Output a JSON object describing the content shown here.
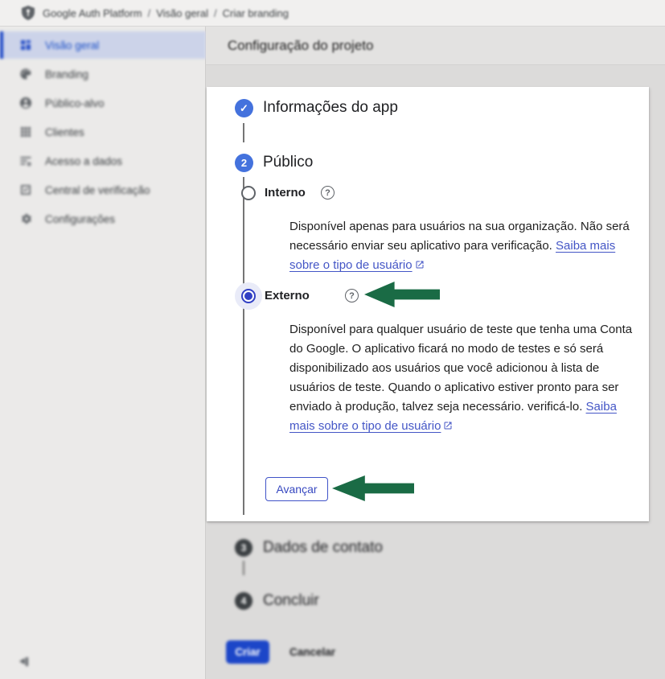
{
  "colors": {
    "step_blue": "#4472dd",
    "radio_selected_blue": "#3140c4",
    "link_blue": "#4456c6",
    "create_button_blue": "#1c46c8",
    "annotation_arrow_green": "#1a6b45",
    "sidebar_selected_bg": "#ccd3e9",
    "sidebar_selected_text": "#1b50c8"
  },
  "topbar": {
    "breadcrumb": {
      "root": "Google Auth Platform",
      "separator": "/",
      "section": "Visão geral",
      "page": "Criar branding"
    }
  },
  "sidebar": {
    "items": [
      {
        "label": "Visão geral",
        "icon": "overview-icon",
        "selected": true
      },
      {
        "label": "Branding",
        "icon": "branding-icon",
        "selected": false
      },
      {
        "label": "Público-alvo",
        "icon": "audience-icon",
        "selected": false
      },
      {
        "label": "Clientes",
        "icon": "clients-icon",
        "selected": false
      },
      {
        "label": "Acesso a dados",
        "icon": "data-access-icon",
        "selected": false
      },
      {
        "label": "Central de verificação",
        "icon": "verification-center-icon",
        "selected": false
      },
      {
        "label": "Configurações",
        "icon": "settings-icon",
        "selected": false
      }
    ]
  },
  "header": {
    "title": "Configuração do projeto"
  },
  "wizard": {
    "step1": {
      "number": "1",
      "label": "Informações do app",
      "state": "done",
      "check_glyph": "✓"
    },
    "step2": {
      "number": "2",
      "label": "Público",
      "state": "active"
    },
    "step3": {
      "number": "3",
      "label": "Dados de contato",
      "state": "pending"
    },
    "step4": {
      "number": "4",
      "label": "Concluir",
      "state": "pending"
    },
    "publico": {
      "help_glyph": "?",
      "interno": {
        "label": "Interno",
        "selected": false,
        "description": "Disponível apenas para usuários na sua organização. Não será necessário enviar seu aplicativo para verificação. ",
        "link": "Saiba mais sobre o tipo de usuário"
      },
      "externo": {
        "label": "Externo",
        "selected": true,
        "description": "Disponível para qualquer usuário de teste que tenha uma Conta do Google. O aplicativo ficará no modo de testes e só será disponibilizado aos usuários que você adicionou à lista de usuários de teste. Quando o aplicativo estiver pronto para ser enviado à produção, talvez seja necessário. verificá-lo. ",
        "link": "Saiba mais sobre o tipo de usuário"
      },
      "next_button": "Avançar"
    },
    "footer": {
      "create_button": "Criar",
      "cancel_button": "Cancelar"
    }
  }
}
